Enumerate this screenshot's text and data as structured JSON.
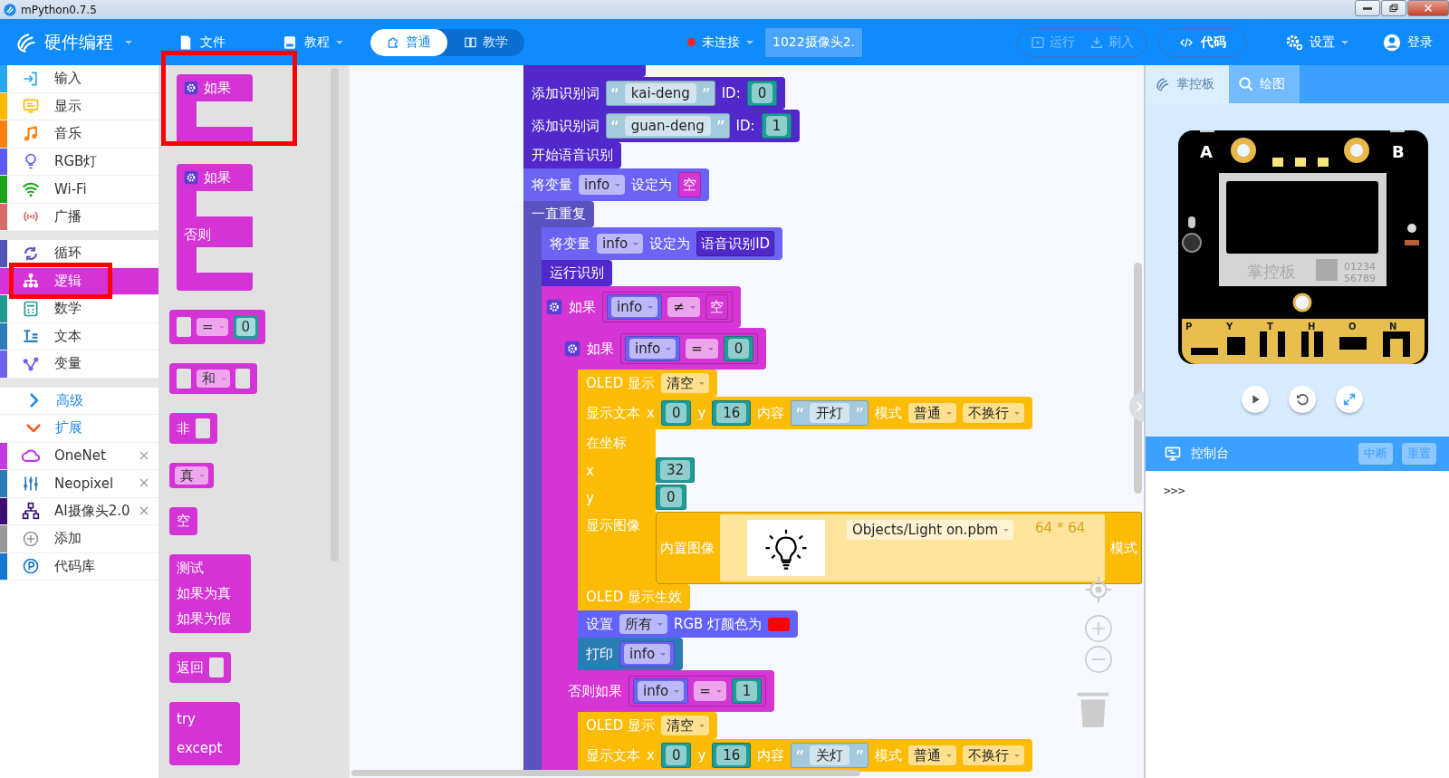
{
  "window": {
    "title": "mPython0.7.5"
  },
  "toolbar": {
    "mode_menu": {
      "label": "硬件编程"
    },
    "menus": [
      {
        "label": "文件",
        "dropdown": false
      },
      {
        "label": "教程",
        "dropdown": true
      }
    ],
    "view_tabs": [
      {
        "label": "普通",
        "selected": true
      },
      {
        "label": "教学",
        "selected": false
      }
    ],
    "connection": {
      "label": "未连接",
      "connected": false
    },
    "device": {
      "label": "1022摄像头2."
    },
    "actions": [
      {
        "label": "运行",
        "disabled": true
      },
      {
        "label": "刷入",
        "disabled": true
      }
    ],
    "code_button": {
      "label": "代码"
    },
    "settings": {
      "label": "设置"
    },
    "login": {
      "label": "登录"
    }
  },
  "sidebar": {
    "groups": [
      {
        "items": [
          {
            "kind": "category",
            "label": "输入",
            "color": "#27a7f0",
            "selected": false,
            "highlight": false,
            "closable": false
          },
          {
            "kind": "category",
            "label": "显示",
            "color": "#fcb900",
            "selected": false,
            "highlight": false,
            "closable": false
          },
          {
            "kind": "category",
            "label": "音乐",
            "color": "#ff7f0e",
            "selected": false,
            "highlight": false,
            "closable": false
          },
          {
            "kind": "category",
            "label": "RGB灯",
            "color": "#5c5cf5",
            "selected": false,
            "highlight": false,
            "closable": false
          },
          {
            "kind": "category",
            "label": "Wi-Fi",
            "color": "#1aa31a",
            "selected": false,
            "highlight": false,
            "closable": false
          },
          {
            "kind": "category",
            "label": "广播",
            "color": "#d76b6b",
            "selected": false,
            "highlight": false,
            "closable": false
          }
        ]
      },
      {
        "items": [
          {
            "kind": "category",
            "label": "循环",
            "color": "#5353b8",
            "selected": false,
            "highlight": false,
            "closable": false
          },
          {
            "kind": "category",
            "label": "逻辑",
            "color": "#d433d6",
            "selected": true,
            "highlight": true,
            "closable": false
          },
          {
            "kind": "category",
            "label": "数学",
            "color": "#1f9b94",
            "selected": false,
            "highlight": false,
            "closable": false
          },
          {
            "kind": "category",
            "label": "文本",
            "color": "#2d7cb8",
            "selected": false,
            "highlight": false,
            "closable": false
          },
          {
            "kind": "category",
            "label": "变量",
            "color": "#6c62f0",
            "selected": false,
            "highlight": false,
            "closable": false
          }
        ]
      },
      {
        "items": [
          {
            "kind": "section",
            "label": "高级",
            "expanded": false
          },
          {
            "kind": "section",
            "label": "扩展",
            "expanded": true
          },
          {
            "kind": "category",
            "label": "OneNet",
            "color": "#c03ae0",
            "selected": false,
            "highlight": false,
            "closable": true
          },
          {
            "kind": "category",
            "label": "Neopixel",
            "color": "#2a7ab5",
            "selected": false,
            "highlight": false,
            "closable": true
          },
          {
            "kind": "category",
            "label": "AI摄像头2.0",
            "color": "#3a0f70",
            "selected": false,
            "highlight": false,
            "closable": true
          },
          {
            "kind": "category",
            "label": "添加",
            "color": "#999999",
            "selected": false,
            "highlight": false,
            "closable": false
          },
          {
            "kind": "category",
            "label": "代码库",
            "color": "#1478d2",
            "selected": false,
            "highlight": false,
            "closable": false
          }
        ]
      }
    ]
  },
  "flyout": {
    "blocks": [
      {
        "kind": "if",
        "labels": [
          "如果"
        ],
        "highlight": true
      },
      {
        "kind": "if_else",
        "labels": [
          "如果",
          "否则"
        ],
        "highlight": false
      },
      {
        "kind": "compare",
        "labels": [
          "=",
          "0"
        ],
        "highlight": false
      },
      {
        "kind": "logic_op",
        "labels": [
          "和"
        ],
        "highlight": false
      },
      {
        "kind": "not",
        "labels": [
          "非"
        ],
        "highlight": false
      },
      {
        "kind": "boolean",
        "labels": [
          "真"
        ],
        "highlight": false
      },
      {
        "kind": "null",
        "labels": [
          "空"
        ],
        "highlight": false
      },
      {
        "kind": "ternary",
        "labels": [
          "测试",
          "如果为真",
          "如果为假"
        ],
        "highlight": false
      },
      {
        "kind": "return",
        "labels": [
          "返回"
        ],
        "highlight": false
      },
      {
        "kind": "try",
        "labels": [
          "try",
          "except"
        ],
        "highlight": false
      }
    ]
  },
  "workspace": {
    "blocks": [
      {
        "kind": "stub",
        "color": "#5128cc"
      },
      {
        "kind": "statement",
        "color": "#5128cc",
        "parts": [
          {
            "kind": "label",
            "text": "添加识别词"
          },
          {
            "kind": "block",
            "color": "#a4cade",
            "parts": [
              {
                "kind": "label",
                "text": "“"
              },
              {
                "kind": "field",
                "text": "kai-deng"
              },
              {
                "kind": "label",
                "text": "”"
              }
            ]
          },
          {
            "kind": "label",
            "text": "ID:"
          },
          {
            "kind": "block",
            "color": "#1e9c99",
            "parts": [
              {
                "kind": "field",
                "text": "0"
              }
            ]
          }
        ]
      },
      {
        "kind": "statement",
        "color": "#5128cc",
        "parts": [
          {
            "kind": "label",
            "text": "添加识别词"
          },
          {
            "kind": "block",
            "color": "#a4cade",
            "parts": [
              {
                "kind": "label",
                "text": "“"
              },
              {
                "kind": "field",
                "text": "guan-deng"
              },
              {
                "kind": "label",
                "text": "”"
              }
            ]
          },
          {
            "kind": "label",
            "text": "ID:"
          },
          {
            "kind": "block",
            "color": "#1e9c99",
            "parts": [
              {
                "kind": "field",
                "text": "1"
              }
            ]
          }
        ]
      },
      {
        "kind": "statement",
        "color": "#5128cc",
        "parts": [
          {
            "kind": "label",
            "text": "开始语音识别"
          }
        ]
      },
      {
        "kind": "statement",
        "color": "#6a63f4",
        "parts": [
          {
            "kind": "label",
            "text": "将变量"
          },
          {
            "kind": "dropdown",
            "text": "info"
          },
          {
            "kind": "label",
            "text": "设定为"
          },
          {
            "kind": "block",
            "color": "#d435d4",
            "parts": [
              {
                "kind": "label",
                "text": "空"
              }
            ]
          }
        ]
      },
      {
        "kind": "loop",
        "color": "#5a52c0",
        "parts": [
          {
            "kind": "label",
            "text": "一直重复"
          }
        ],
        "children": [
          {
            "kind": "statement",
            "color": "#6a63f4",
            "parts": [
              {
                "kind": "label",
                "text": "将变量"
              },
              {
                "kind": "dropdown",
                "text": "info"
              },
              {
                "kind": "label",
                "text": "设定为"
              },
              {
                "kind": "block",
                "color": "#5128cc",
                "parts": [
                  {
                    "kind": "label",
                    "text": "语音识别ID"
                  }
                ]
              }
            ]
          },
          {
            "kind": "statement",
            "color": "#5128cc",
            "parts": [
              {
                "kind": "label",
                "text": "运行识别"
              }
            ]
          },
          {
            "kind": "if",
            "color": "#d435d4",
            "mutator": true,
            "branches": [
              {
                "parts": [
                  {
                    "kind": "label",
                    "text": "如果"
                  },
                  {
                    "kind": "block",
                    "color": "#d435d4",
                    "parts": [
                      {
                        "kind": "block",
                        "color": "#6a63f4",
                        "parts": [
                          {
                            "kind": "dropdown",
                            "text": "info"
                          }
                        ]
                      },
                      {
                        "kind": "dropdown",
                        "text": "≠"
                      },
                      {
                        "kind": "block",
                        "color": "#d435d4",
                        "parts": [
                          {
                            "kind": "label",
                            "text": "空"
                          }
                        ]
                      }
                    ]
                  }
                ],
                "children": [
                  {
                    "kind": "if",
                    "color": "#d435d4",
                    "mutator": true,
                    "branches": [
                      {
                        "parts": [
                          {
                            "kind": "label",
                            "text": "如果"
                          },
                          {
                            "kind": "block",
                            "color": "#d435d4",
                            "parts": [
                              {
                                "kind": "block",
                                "color": "#6a63f4",
                                "parts": [
                                  {
                                    "kind": "dropdown",
                                    "text": "info"
                                  }
                                ]
                              },
                              {
                                "kind": "dropdown",
                                "text": "="
                              },
                              {
                                "kind": "block",
                                "color": "#1e9c99",
                                "parts": [
                                  {
                                    "kind": "field",
                                    "text": "0"
                                  }
                                ]
                              }
                            ]
                          }
                        ],
                        "children": [
                          {
                            "kind": "statement",
                            "color": "#fcbb05",
                            "parts": [
                              {
                                "kind": "label",
                                "text": "OLED 显示"
                              },
                              {
                                "kind": "dropdown",
                                "text": "清空"
                              }
                            ]
                          },
                          {
                            "kind": "statement",
                            "color": "#fcbb05",
                            "parts": [
                              {
                                "kind": "label",
                                "text": "显示文本"
                              },
                              {
                                "kind": "label",
                                "text": "x"
                              },
                              {
                                "kind": "block",
                                "color": "#1e9c99",
                                "parts": [
                                  {
                                    "kind": "field",
                                    "text": "0"
                                  }
                                ]
                              },
                              {
                                "kind": "label",
                                "text": "y"
                              },
                              {
                                "kind": "block",
                                "color": "#1e9c99",
                                "parts": [
                                  {
                                    "kind": "field",
                                    "text": "16"
                                  }
                                ]
                              },
                              {
                                "kind": "label",
                                "text": "内容"
                              },
                              {
                                "kind": "block",
                                "color": "#a4cade",
                                "parts": [
                                  {
                                    "kind": "label",
                                    "text": "“"
                                  },
                                  {
                                    "kind": "field",
                                    "text": "开灯"
                                  },
                                  {
                                    "kind": "label",
                                    "text": "”"
                                  }
                                ]
                              },
                              {
                                "kind": "label",
                                "text": "模式"
                              },
                              {
                                "kind": "dropdown",
                                "text": "普通"
                              },
                              {
                                "kind": "dropdown",
                                "text": "不换行"
                              }
                            ]
                          },
                          {
                            "kind": "rows",
                            "color": "#fcbb05",
                            "rows": [
                              {
                                "parts": [
                                  {
                                    "kind": "label",
                                    "text": "在坐标"
                                  }
                                ]
                              },
                              {
                                "parts": [
                                  {
                                    "kind": "label",
                                    "text": "x"
                                  },
                                  {
                                    "kind": "block",
                                    "color": "#1e9c99",
                                    "parts": [
                                      {
                                        "kind": "field",
                                        "text": "32"
                                      }
                                    ]
                                  }
                                ]
                              },
                              {
                                "parts": [
                                  {
                                    "kind": "label",
                                    "text": "y"
                                  },
                                  {
                                    "kind": "block",
                                    "color": "#1e9c99",
                                    "parts": [
                                      {
                                        "kind": "field",
                                        "text": "0"
                                      }
                                    ]
                                  }
                                ]
                              },
                              {
                                "parts": [
                                  {
                                    "kind": "label",
                                    "text": "显示图像"
                                  },
                                  {
                                    "kind": "block",
                                    "color": "#fcbb05",
                                    "parts": [
                                      {
                                        "kind": "label",
                                        "text": "内置图像"
                                      },
                                      {
                                        "kind": "panel",
                                        "parts": [
                                          {
                                            "kind": "image"
                                          },
                                          {
                                            "kind": "dropdown",
                                            "text": "Objects/Light on.pbm"
                                          },
                                          {
                                            "kind": "label",
                                            "text": "64 * 64"
                                          }
                                        ]
                                      },
                                      {
                                        "kind": "label",
                                        "text": "模式"
                                      }
                                    ]
                                  }
                                ]
                              }
                            ]
                          },
                          {
                            "kind": "statement",
                            "color": "#fcbb05",
                            "parts": [
                              {
                                "kind": "label",
                                "text": "OLED 显示生效"
                              }
                            ]
                          },
                          {
                            "kind": "statement",
                            "color": "#6262fb",
                            "parts": [
                              {
                                "kind": "label",
                                "text": "设置"
                              },
                              {
                                "kind": "dropdown",
                                "text": "所有"
                              },
                              {
                                "kind": "label",
                                "text": "RGB 灯颜色为"
                              },
                              {
                                "kind": "color",
                                "color": "#ff0000"
                              }
                            ]
                          },
                          {
                            "kind": "statement",
                            "color": "#2a7db5",
                            "parts": [
                              {
                                "kind": "label",
                                "text": "打印"
                              },
                              {
                                "kind": "block",
                                "color": "#6a63f4",
                                "parts": [
                                  {
                                    "kind": "dropdown",
                                    "text": "info"
                                  }
                                ]
                              }
                            ]
                          }
                        ]
                      },
                      {
                        "parts": [
                          {
                            "kind": "label",
                            "text": "否则如果"
                          },
                          {
                            "kind": "block",
                            "color": "#d435d4",
                            "parts": [
                              {
                                "kind": "block",
                                "color": "#6a63f4",
                                "parts": [
                                  {
                                    "kind": "dropdown",
                                    "text": "info"
                                  }
                                ]
                              },
                              {
                                "kind": "dropdown",
                                "text": "="
                              },
                              {
                                "kind": "block",
                                "color": "#1e9c99",
                                "parts": [
                                  {
                                    "kind": "field",
                                    "text": "1"
                                  }
                                ]
                              }
                            ]
                          }
                        ],
                        "children": [
                          {
                            "kind": "statement",
                            "color": "#fcbb05",
                            "parts": [
                              {
                                "kind": "label",
                                "text": "OLED 显示"
                              },
                              {
                                "kind": "dropdown",
                                "text": "清空"
                              }
                            ]
                          },
                          {
                            "kind": "statement",
                            "color": "#fcbb05",
                            "parts": [
                              {
                                "kind": "label",
                                "text": "显示文本"
                              },
                              {
                                "kind": "label",
                                "text": "x"
                              },
                              {
                                "kind": "block",
                                "color": "#1e9c99",
                                "parts": [
                                  {
                                    "kind": "field",
                                    "text": "0"
                                  }
                                ]
                              },
                              {
                                "kind": "label",
                                "text": "y"
                              },
                              {
                                "kind": "block",
                                "color": "#1e9c99",
                                "parts": [
                                  {
                                    "kind": "field",
                                    "text": "16"
                                  }
                                ]
                              },
                              {
                                "kind": "label",
                                "text": "内容"
                              },
                              {
                                "kind": "block",
                                "color": "#a4cade",
                                "parts": [
                                  {
                                    "kind": "label",
                                    "text": "“"
                                  },
                                  {
                                    "kind": "field",
                                    "text": "关灯"
                                  },
                                  {
                                    "kind": "label",
                                    "text": "”"
                                  }
                                ]
                              },
                              {
                                "kind": "label",
                                "text": "模式"
                              },
                              {
                                "kind": "dropdown",
                                "text": "普通"
                              },
                              {
                                "kind": "dropdown",
                                "text": "不换行"
                              }
                            ]
                          }
                        ]
                      }
                    ]
                  }
                ]
              }
            ]
          }
        ]
      }
    ]
  },
  "device_panel": {
    "tabs": [
      {
        "label": "掌控板",
        "selected": true
      },
      {
        "label": "绘图",
        "selected": false
      }
    ],
    "board": {
      "button_a": "A",
      "button_b": "B",
      "logo": "掌控板",
      "serial": [
        "01234",
        "56789"
      ],
      "pins": [
        "P",
        "Y",
        "T",
        "H",
        "O",
        "N"
      ]
    },
    "console": {
      "title": "控制台",
      "buttons": [
        {
          "label": "中断"
        },
        {
          "label": "重置"
        }
      ],
      "output": ">>>"
    }
  }
}
